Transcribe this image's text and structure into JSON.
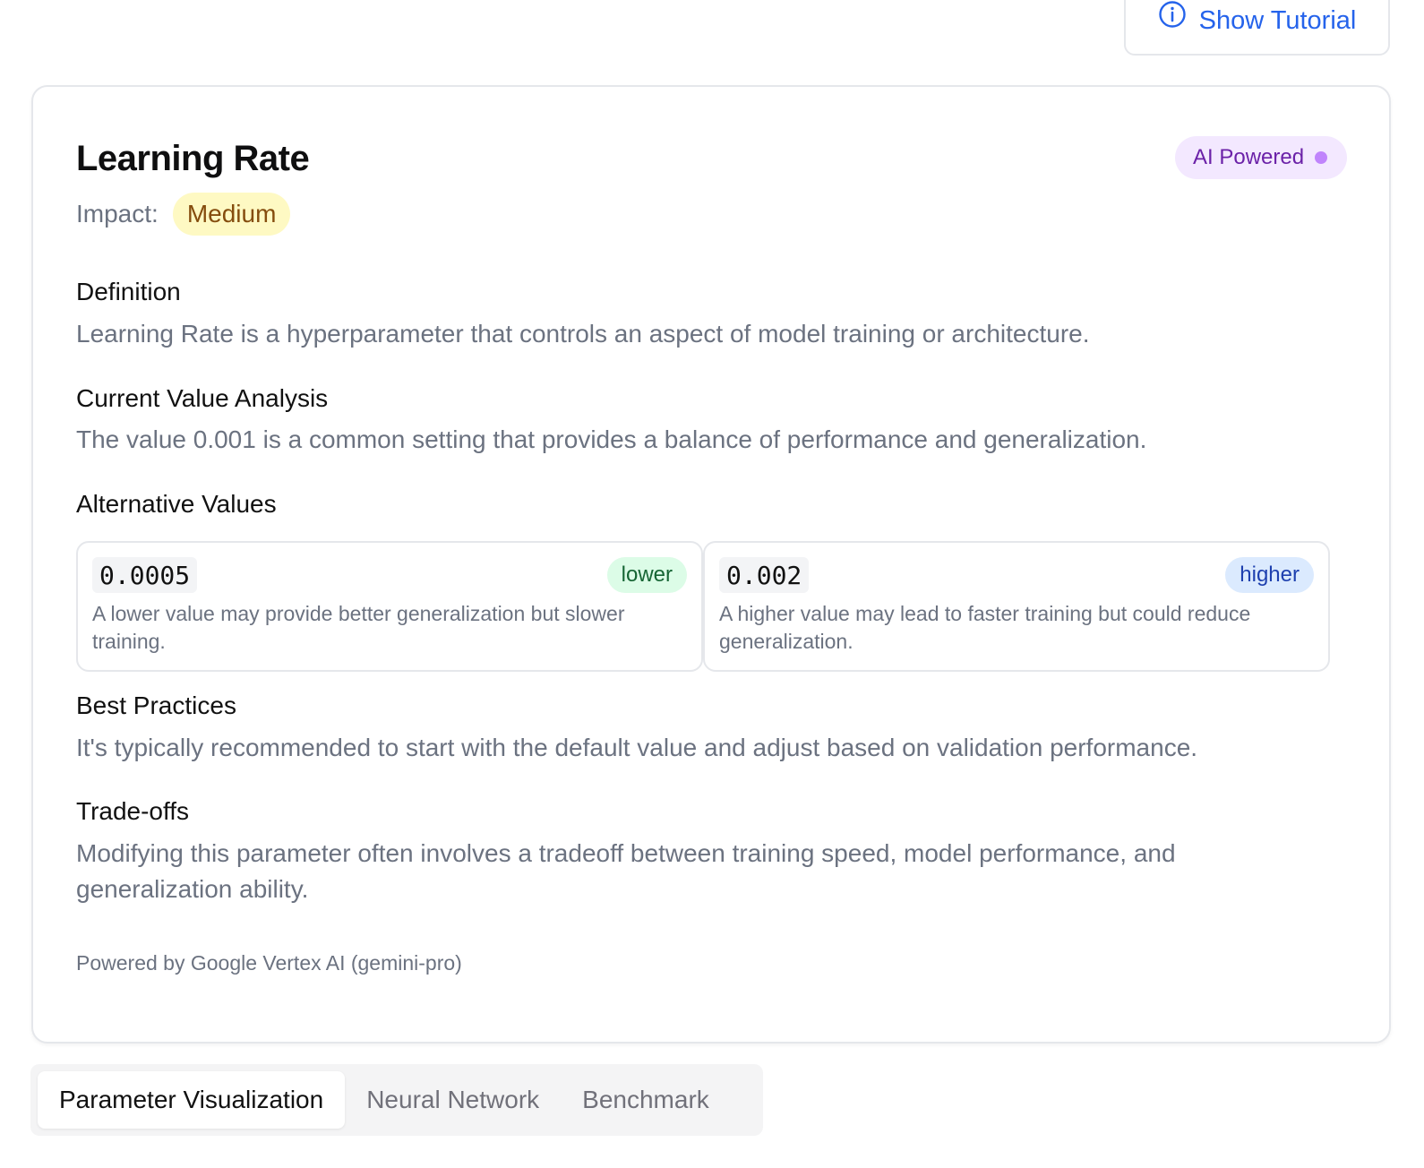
{
  "header": {
    "tutorial_button": "Show Tutorial"
  },
  "card": {
    "title": "Learning Rate",
    "ai_badge": "AI Powered",
    "impact_label": "Impact:",
    "impact_value": "Medium",
    "sections": {
      "definition_heading": "Definition",
      "definition_text": "Learning Rate is a hyperparameter that controls an aspect of model training or architecture.",
      "current_heading": "Current Value Analysis",
      "current_text": "The value 0.001 is a common setting that provides a balance of performance and generalization.",
      "alternatives_heading": "Alternative Values",
      "best_heading": "Best Practices",
      "best_text": "It's typically recommended to start with the default value and adjust based on validation performance.",
      "tradeoffs_heading": "Trade-offs",
      "tradeoffs_text": "Modifying this parameter often involves a tradeoff between training speed, model performance, and generalization ability."
    },
    "alternatives": [
      {
        "value": "0.0005",
        "tag": "lower",
        "description": "A lower value may provide better generalization but slower training."
      },
      {
        "value": "0.002",
        "tag": "higher",
        "description": "A higher value may lead to faster training but could reduce generalization."
      }
    ],
    "footer": "Powered by Google Vertex AI (gemini-pro)"
  },
  "tabs": [
    {
      "label": "Parameter Visualization",
      "active": true
    },
    {
      "label": "Neural Network",
      "active": false
    },
    {
      "label": "Benchmark",
      "active": false
    }
  ],
  "colors": {
    "accent": "#2563eb",
    "ai_badge_bg": "#f3e8ff",
    "impact_bg": "#fef9c3",
    "lower_bg": "#dcfce7",
    "higher_bg": "#dbeafe"
  }
}
